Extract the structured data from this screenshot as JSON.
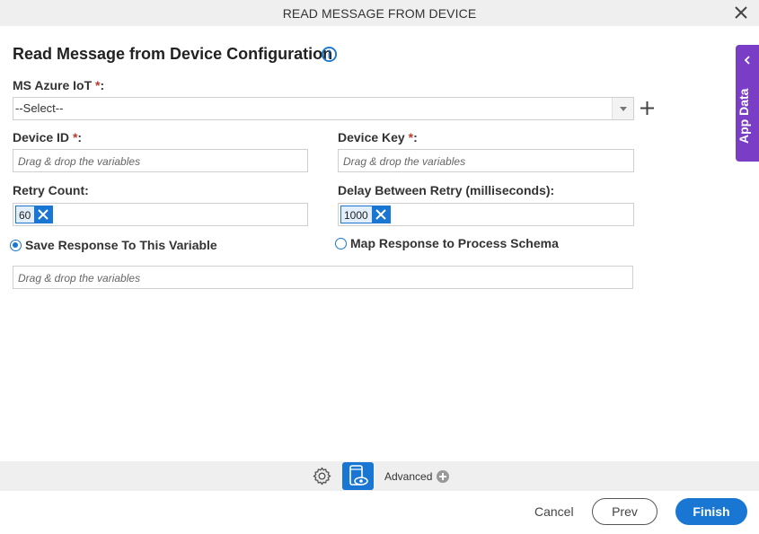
{
  "dialog": {
    "title": "READ MESSAGE FROM DEVICE",
    "close_icon": "close-icon"
  },
  "form": {
    "heading": "Read Message from Device Configuration",
    "info_icon": "info-icon",
    "azure_iot": {
      "label": "MS Azure IoT",
      "required_mark": "*",
      "colon": ":",
      "selected": "--Select--",
      "add_icon": "plus-icon"
    },
    "device_id": {
      "label": "Device ID",
      "required_mark": "*",
      "colon": ":",
      "placeholder": "Drag & drop the variables"
    },
    "device_key": {
      "label": "Device Key",
      "required_mark": "*",
      "colon": ":",
      "placeholder": "Drag & drop the variables"
    },
    "retry_count": {
      "label": "Retry Count:",
      "value": "60"
    },
    "delay_between_retry": {
      "label": "Delay Between Retry (milliseconds):",
      "value": "1000"
    },
    "response_options": [
      {
        "label": "Save Response To This Variable",
        "selected": true
      },
      {
        "label": "Map Response to Process Schema",
        "selected": false
      }
    ],
    "response_variable": {
      "placeholder": "Drag & drop the variables"
    }
  },
  "side_panel": {
    "label": "App Data",
    "color": "#7a3dc5"
  },
  "toolbar": {
    "settings_icon": "gear-icon",
    "preview_icon": "mobile-preview-icon",
    "advanced_label": "Advanced"
  },
  "footer": {
    "cancel_label": "Cancel",
    "prev_label": "Prev",
    "finish_label": "Finish"
  },
  "colors": {
    "accent": "#1976d2",
    "required": "#c0392b"
  }
}
